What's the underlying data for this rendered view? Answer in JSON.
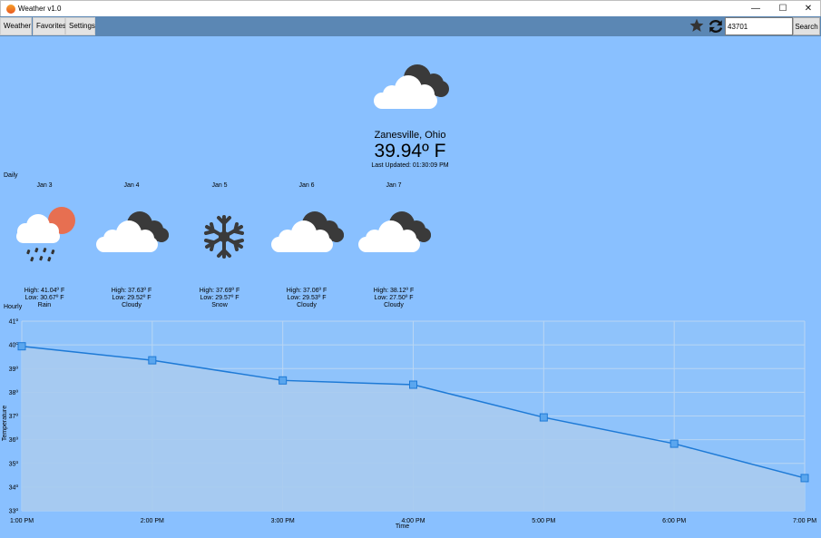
{
  "window": {
    "title": "Weather v1.0",
    "minimize": "—",
    "maximize": "☐",
    "close": "✕"
  },
  "toolbar": {
    "menu": [
      "Weather",
      "Favorites",
      "Settings"
    ],
    "search_value": "43701",
    "search_label": "Search",
    "favorite_icon": "star-icon",
    "refresh_icon": "refresh-icon"
  },
  "current": {
    "location": "Zanesville, Ohio",
    "temperature": "39.94º F",
    "updated": "Last Updated: 01:30:09 PM",
    "icon": "cloudy-icon"
  },
  "daily": {
    "label": "Daily",
    "days": [
      {
        "date": "Jan 3",
        "high": "High: 41.04º F",
        "low": "Low: 30.67º F",
        "condition": "Rain",
        "icon": "rain-icon"
      },
      {
        "date": "Jan 4",
        "high": "High: 37.63º F",
        "low": "Low: 29.52º F",
        "condition": "Cloudy",
        "icon": "cloudy-icon"
      },
      {
        "date": "Jan 5",
        "high": "High: 37.69º F",
        "low": "Low: 29.57º F",
        "condition": "Snow",
        "icon": "snow-icon"
      },
      {
        "date": "Jan 6",
        "high": "High: 37.06º F",
        "low": "Low: 29.53º F",
        "condition": "Cloudy",
        "icon": "cloudy-icon"
      },
      {
        "date": "Jan 7",
        "high": "High: 38.12º F",
        "low": "Low: 27.50º F",
        "condition": "Cloudy",
        "icon": "cloudy-icon"
      }
    ]
  },
  "hourly": {
    "label": "Hourly"
  },
  "colors": {
    "background": "#89c0ff",
    "toolbar": "#5b87b4",
    "line": "#1e7ad6",
    "area": "#a9cbef",
    "marker": "#5aa6ee"
  },
  "chart_data": {
    "type": "area",
    "categories": [
      "1:00 PM",
      "2:00 PM",
      "3:00 PM",
      "4:00 PM",
      "5:00 PM",
      "6:00 PM",
      "7:00 PM"
    ],
    "series": [
      {
        "values": [
          39.94,
          39.35,
          38.5,
          38.32,
          36.94,
          35.83,
          34.38
        ]
      }
    ],
    "yticks": [
      "33º",
      "34º",
      "35º",
      "36º",
      "37º",
      "38º",
      "39º",
      "40º",
      "41º"
    ],
    "ylim": [
      33,
      41
    ],
    "xlabel": "Time",
    "ylabel": "Temperature",
    "grid": true
  }
}
